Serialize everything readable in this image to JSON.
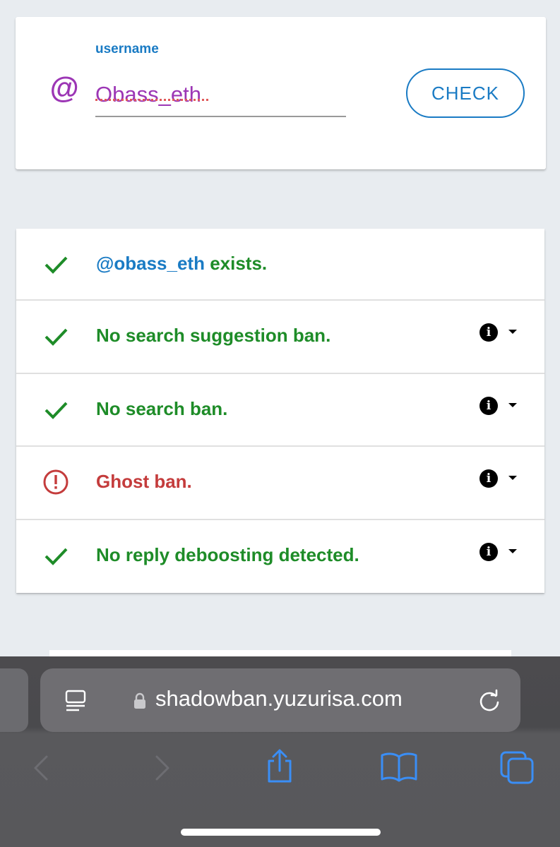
{
  "search": {
    "label": "username",
    "at_symbol": "@",
    "value": "Obass_eth",
    "check_button": "CHECK"
  },
  "results": [
    {
      "status": "ok",
      "handle": "@obass_eth",
      "text": " exists.",
      "has_info": false
    },
    {
      "status": "ok",
      "text": "No search suggestion ban.",
      "has_info": true
    },
    {
      "status": "ok",
      "text": "No search ban.",
      "has_info": true
    },
    {
      "status": "error",
      "text": "Ghost ban.",
      "has_info": true
    },
    {
      "status": "ok",
      "text": "No reply deboosting detected.",
      "has_info": true
    }
  ],
  "browser": {
    "url": "shadowban.yuzurisa.com",
    "toolbar": [
      "back-icon",
      "forward-icon",
      "share-icon",
      "bookmarks-icon",
      "tabs-icon"
    ]
  },
  "colors": {
    "accent_blue": "#1a7bc4",
    "ok_green": "#1e8c28",
    "error_red": "#c43c3c",
    "username_purple": "#9c36b5",
    "ios_blue": "#3a8ef6"
  },
  "icons": {
    "ok": "check-icon",
    "error": "exclamation-circle-icon",
    "info": "info-icon",
    "expand": "caret-down-icon"
  }
}
